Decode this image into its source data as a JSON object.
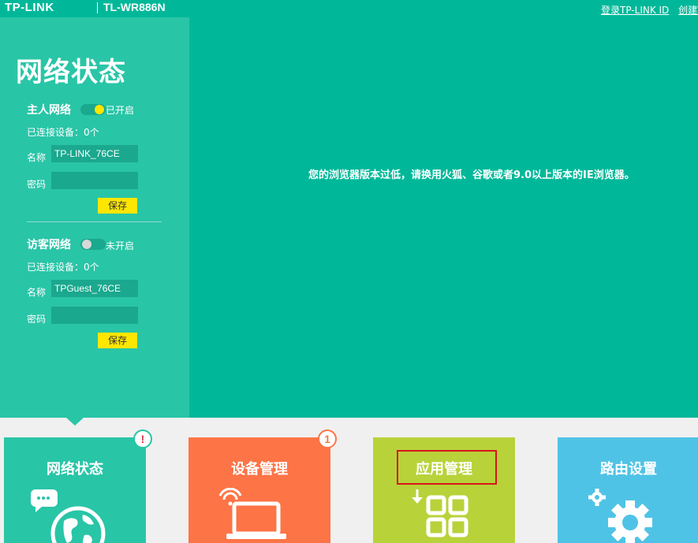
{
  "header": {
    "brand": "TP-LINK",
    "model": "TL-WR886N",
    "login_link": "登录TP-LINK ID",
    "create_link": "创建T"
  },
  "sidebar": {
    "title": "网络状态",
    "host_network": {
      "title": "主人网络",
      "toggle_status": "已开启",
      "toggle_on": true,
      "connected_devices": "已连接设备：0个",
      "name_label": "名称",
      "name_value": "TP-LINK_76CE",
      "password_label": "密码",
      "password_value": "",
      "save_label": "保存"
    },
    "guest_network": {
      "title": "访客网络",
      "toggle_status": "未开启",
      "toggle_on": false,
      "connected_devices": "已连接设备：0个",
      "name_label": "名称",
      "name_value": "TPGuest_76CE",
      "password_label": "密码",
      "password_value": "",
      "save_label": "保存"
    }
  },
  "main": {
    "notice": "您的浏览器版本过低，请换用火狐、谷歌或者9.0以上版本的IE浏览器。"
  },
  "tiles": [
    {
      "label": "网络状态",
      "icon": "globe-chat-icon",
      "color": "#29c5a7",
      "badge": "!",
      "badge_color": "#e0364c"
    },
    {
      "label": "设备管理",
      "icon": "laptop-wifi-icon",
      "color": "#fd7446",
      "badge": "1",
      "badge_color": "#f07c3c"
    },
    {
      "label": "应用管理",
      "icon": "apps-grid-icon",
      "color": "#b8d23a",
      "highlighted": true
    },
    {
      "label": "路由设置",
      "icon": "gear-icon",
      "color": "#4fc3e6"
    }
  ],
  "colors": {
    "main_bg": "#00b899",
    "sidebar_bg": "#29c5a7",
    "input_bg": "#1aa88e",
    "save_button": "#ffe600",
    "toggle_knob_on": "#ffe600",
    "highlight_border": "#d9141c"
  }
}
